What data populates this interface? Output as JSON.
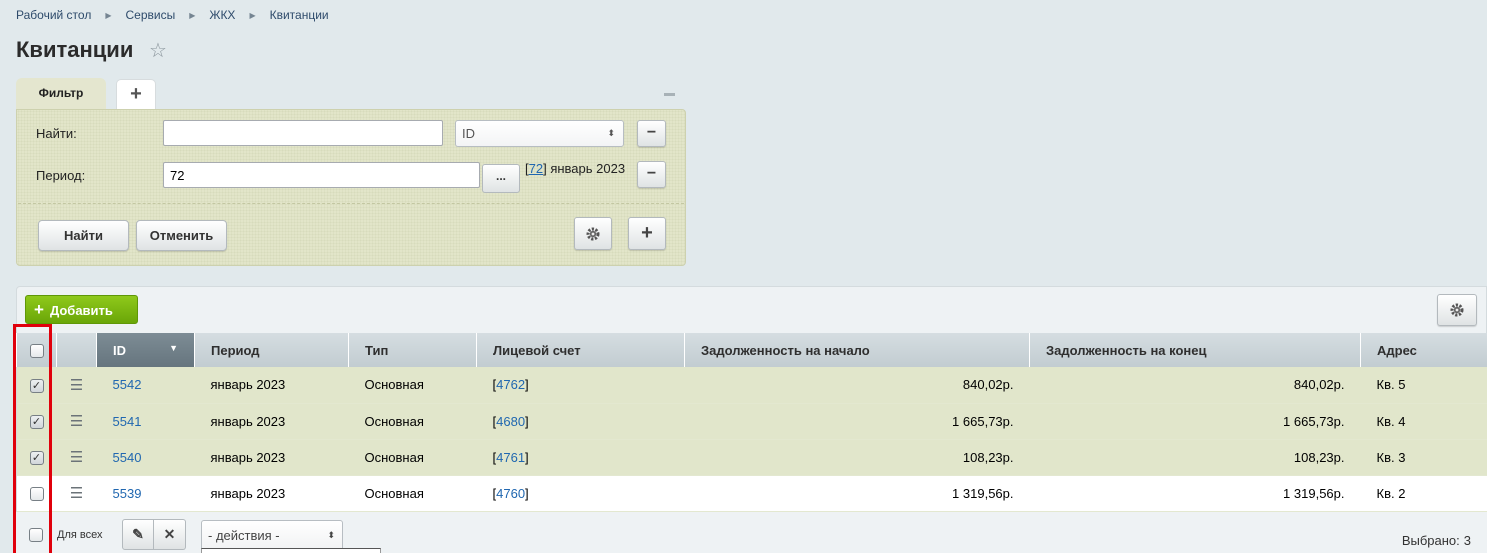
{
  "breadcrumbs": [
    "Рабочий стол",
    "Сервисы",
    "ЖКХ",
    "Квитанции"
  ],
  "page_title": "Квитанции",
  "filter": {
    "tab_label": "Фильтр",
    "find_label": "Найти:",
    "find_value": "",
    "find_field": "ID",
    "period_label": "Период:",
    "period_value": "72",
    "period_browse": "...",
    "period_link": "72",
    "period_text": "январь 2023",
    "find_button": "Найти",
    "cancel_button": "Отменить"
  },
  "toolbar": {
    "add_label": "Добавить"
  },
  "table": {
    "columns": [
      "ID",
      "Период",
      "Тип",
      "Лицевой счет",
      "Задолженность на начало",
      "Задолженность на конец",
      "Адрес"
    ],
    "rows": [
      {
        "id": "5542",
        "period": "январь 2023",
        "type": "Основная",
        "account": "4762",
        "debt_start": "840,02р.",
        "debt_end": "840,02р.",
        "address": "Кв. 5",
        "checked": true
      },
      {
        "id": "5541",
        "period": "январь 2023",
        "type": "Основная",
        "account": "4680",
        "debt_start": "1 665,73р.",
        "debt_end": "1 665,73р.",
        "address": "Кв. 4",
        "checked": true
      },
      {
        "id": "5540",
        "period": "январь 2023",
        "type": "Основная",
        "account": "4761",
        "debt_start": "108,23р.",
        "debt_end": "108,23р.",
        "address": "Кв. 3",
        "checked": true
      },
      {
        "id": "5539",
        "period": "январь 2023",
        "type": "Основная",
        "account": "4760",
        "debt_start": "1 319,56р.",
        "debt_end": "1 319,56р.",
        "address": "Кв. 2",
        "checked": false
      }
    ]
  },
  "footer": {
    "for_all_label": "Для всех",
    "actions_placeholder": "- действия -",
    "selected_label": "Выбрано:",
    "selected_count": "3"
  },
  "colors": {
    "highlight": "#e0000b",
    "accent_green": "#7ab714",
    "selected_row": "#e1e6cb"
  }
}
